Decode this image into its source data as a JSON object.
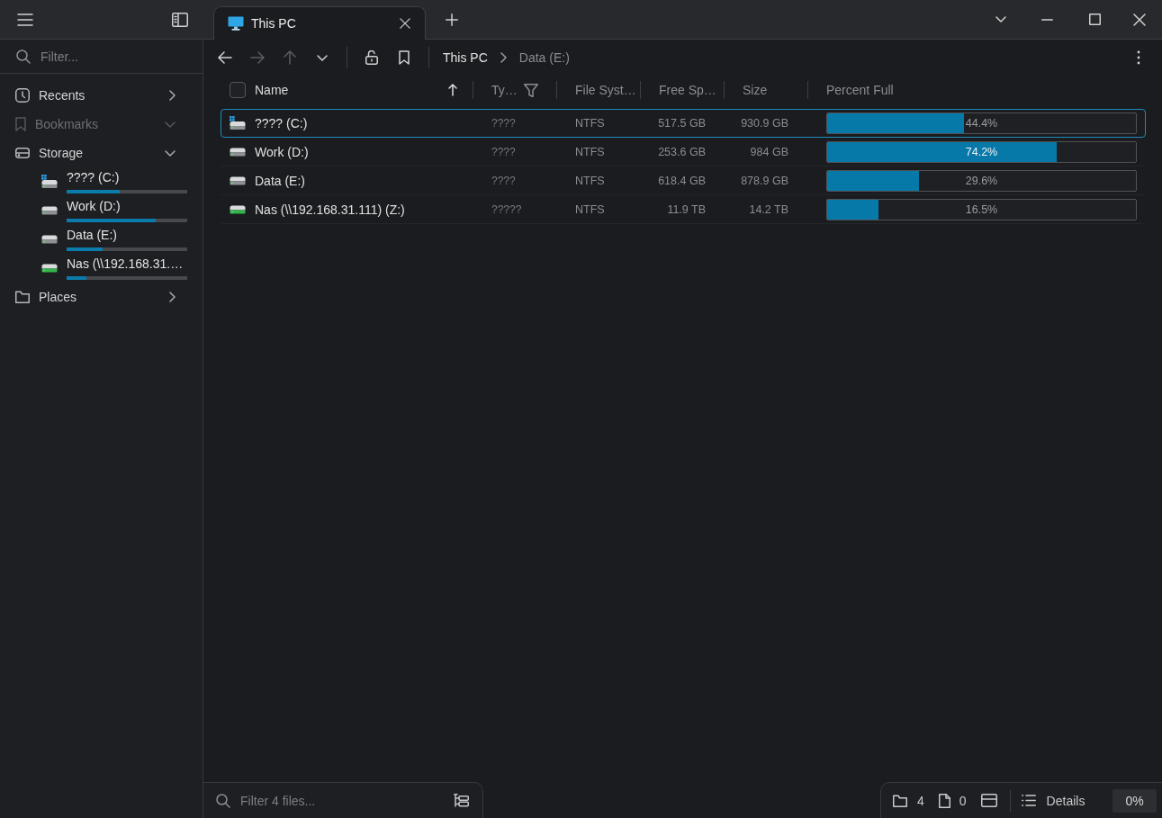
{
  "window": {
    "tabs": [
      {
        "label": "This PC",
        "selected": true
      }
    ]
  },
  "sidebar": {
    "filter": {
      "placeholder": "Filter..."
    },
    "sections": [
      {
        "label": "Recents",
        "kind": "recents",
        "expanded": false,
        "disabled": false
      },
      {
        "label": "Bookmarks",
        "kind": "bookmarks",
        "expanded": true,
        "disabled": true
      },
      {
        "label": "Storage",
        "kind": "storage",
        "expanded": true,
        "disabled": false,
        "children": [
          {
            "label": "???? (C:)",
            "kind": "system",
            "level": 0.444
          },
          {
            "label": "Work (D:)",
            "kind": "local",
            "level": 0.742
          },
          {
            "label": "Data (E:)",
            "kind": "local",
            "level": 0.296
          },
          {
            "label": "Nas (\\\\192.168.31.…",
            "kind": "network",
            "level": 0.165
          }
        ]
      },
      {
        "label": "Places",
        "kind": "places",
        "expanded": false,
        "disabled": false
      }
    ]
  },
  "toolbar": {
    "back": {
      "disabled": false
    },
    "forward": {
      "disabled": true
    },
    "up": {
      "disabled": true
    },
    "breadcrumb": [
      {
        "label": "This PC",
        "selected": true
      },
      {
        "label": "Data (E:)",
        "selected": false
      }
    ]
  },
  "table": {
    "select_all": {
      "checked": false
    },
    "columns": [
      {
        "label": "Name",
        "sorted": true,
        "filter": false
      },
      {
        "label": "Ty…",
        "sorted": false,
        "filter": true
      },
      {
        "label": "File Syst…",
        "sorted": false,
        "filter": false
      },
      {
        "label": "Free Sp…",
        "sorted": false,
        "filter": false
      },
      {
        "label": "Size",
        "sorted": false,
        "filter": false
      },
      {
        "label": "Percent Full",
        "sorted": false,
        "filter": false
      }
    ],
    "rows": [
      {
        "name": "???? (C:)",
        "kind": "system",
        "type": "????",
        "file_system": "NTFS",
        "free_space": "517.5 GB",
        "size": "930.9 GB",
        "percent": "44.4%",
        "level": 0.444,
        "selected": true
      },
      {
        "name": "Work (D:)",
        "kind": "local",
        "type": "????",
        "file_system": "NTFS",
        "free_space": "253.6 GB",
        "size": "984 GB",
        "percent": "74.2%",
        "level": 0.742,
        "selected": false
      },
      {
        "name": "Data (E:)",
        "kind": "local",
        "type": "????",
        "file_system": "NTFS",
        "free_space": "618.4 GB",
        "size": "878.9 GB",
        "percent": "29.6%",
        "level": 0.296,
        "selected": false
      },
      {
        "name": "Nas (\\\\192.168.31.111) (Z:)",
        "kind": "network",
        "type": "?????",
        "file_system": "NTFS",
        "free_space": "11.9 TB",
        "size": "14.2 TB",
        "percent": "16.5%",
        "level": 0.165,
        "selected": false
      }
    ]
  },
  "status_bar": {
    "filter": {
      "placeholder": "Filter 4 files..."
    },
    "folders": "4",
    "files": "0",
    "view": "Details",
    "zoom": "0%"
  }
}
